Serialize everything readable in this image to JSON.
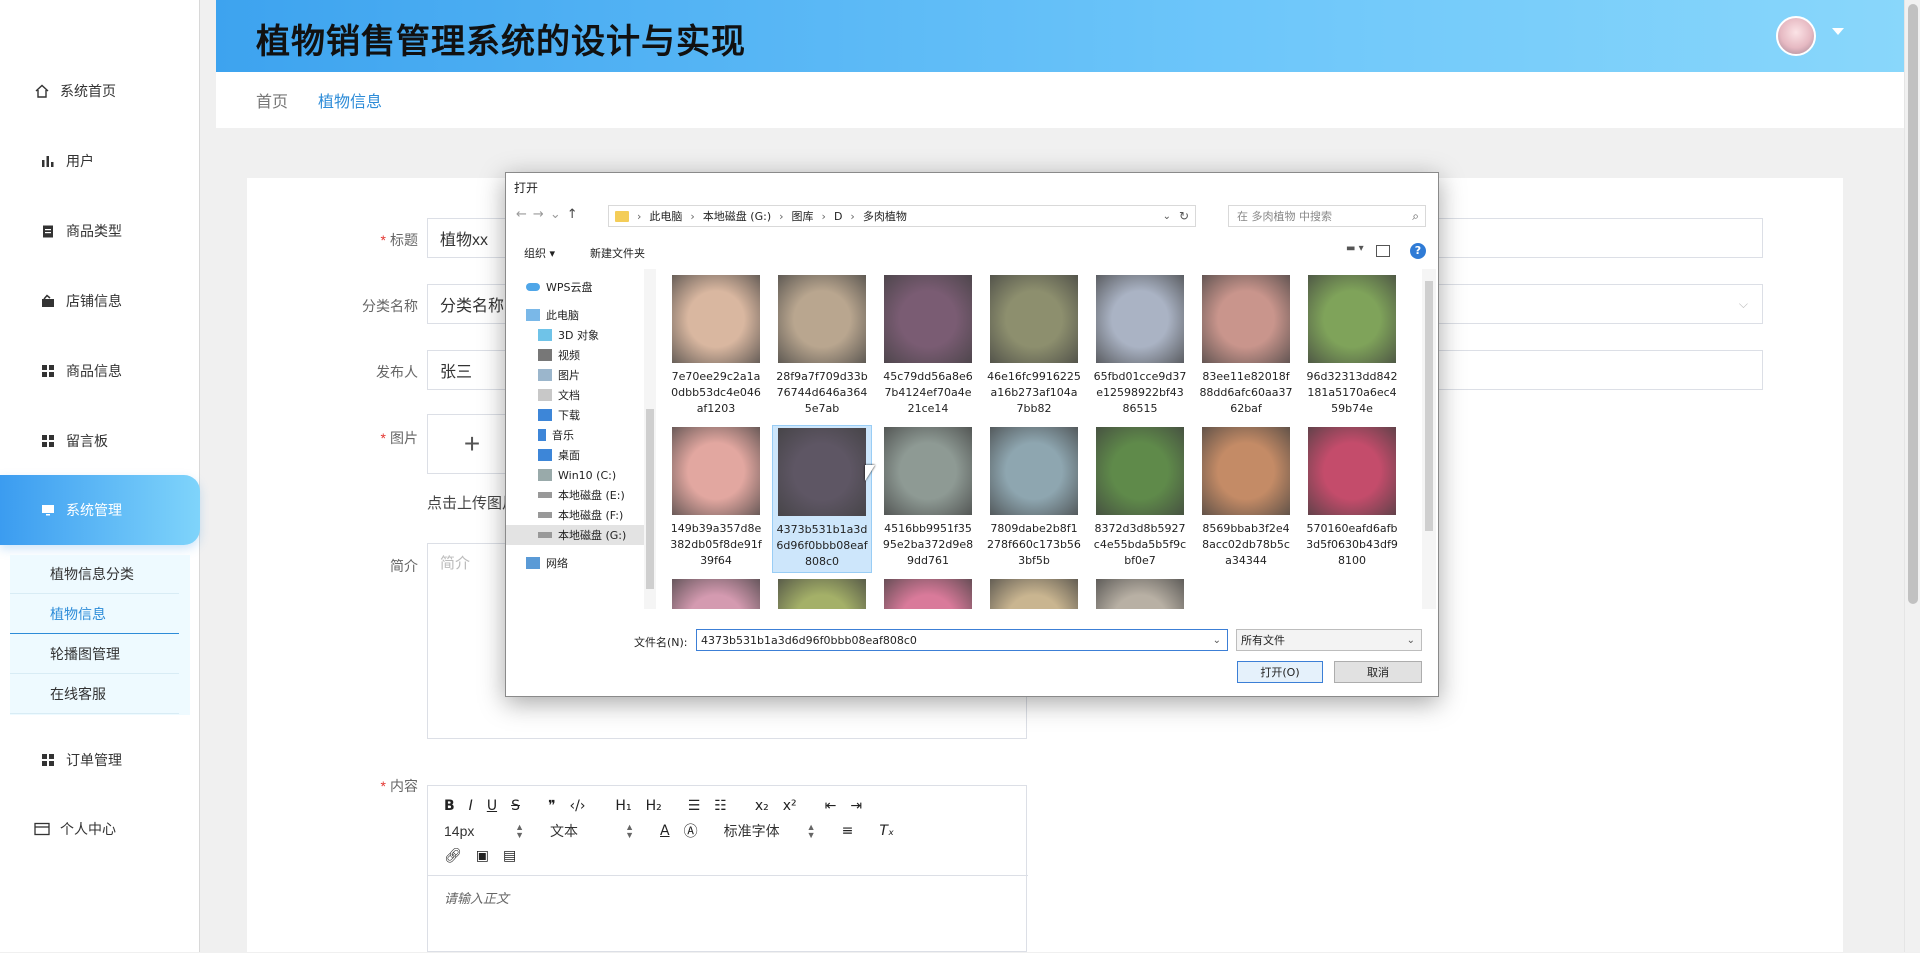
{
  "app": {
    "title": "植物销售管理系统的设计与实现"
  },
  "sidebar": {
    "items": [
      {
        "label": "系统首页",
        "icon": "home-icon"
      },
      {
        "label": "用户",
        "icon": "bar-chart-icon"
      },
      {
        "label": "商品类型",
        "icon": "clipboard-icon"
      },
      {
        "label": "店铺信息",
        "icon": "store-icon"
      },
      {
        "label": "商品信息",
        "icon": "grid-icon"
      },
      {
        "label": "留言板",
        "icon": "grid-icon"
      },
      {
        "label": "系统管理",
        "icon": "monitor-icon"
      },
      {
        "label": "订单管理",
        "icon": "grid-icon"
      },
      {
        "label": "个人中心",
        "icon": "card-icon"
      }
    ],
    "submenu": [
      "植物信息分类",
      "植物信息",
      "轮播图管理",
      "在线客服"
    ]
  },
  "breadcrumb": [
    "首页",
    "植物信息"
  ],
  "form": {
    "title_label": "标题",
    "title_value": "植物xx",
    "category_label": "分类名称",
    "category_value": "分类名称",
    "publisher_label": "发布人",
    "publisher_value": "张三",
    "image_label": "图片",
    "upload_plus": "+",
    "upload_hint": "点击上传图片",
    "intro_label": "简介",
    "intro_placeholder": "简介",
    "content_label": "内容",
    "editor": {
      "font_size": "14px",
      "text_type": "文本",
      "font_family": "标准字体",
      "placeholder": "请输入正文"
    }
  },
  "dialog": {
    "title": "打开",
    "path": [
      "此电脑",
      "本地磁盘 (G:)",
      "图库",
      "D",
      "多肉植物"
    ],
    "search_placeholder": "在 多肉植物 中搜索",
    "organize": "组织",
    "new_folder": "新建文件夹",
    "tree": [
      {
        "label": "WPS云盘",
        "icon": "cloud-icon"
      },
      {
        "label": "此电脑",
        "icon": "computer-icon"
      },
      {
        "label": "3D 对象",
        "icon": "cube-icon"
      },
      {
        "label": "视频",
        "icon": "video-icon"
      },
      {
        "label": "图片",
        "icon": "picture-icon"
      },
      {
        "label": "文档",
        "icon": "document-icon"
      },
      {
        "label": "下载",
        "icon": "download-icon"
      },
      {
        "label": "音乐",
        "icon": "music-icon"
      },
      {
        "label": "桌面",
        "icon": "desktop-icon"
      },
      {
        "label": "Win10 (C:)",
        "icon": "drive-icon"
      },
      {
        "label": "本地磁盘 (E:)",
        "icon": "drive-icon"
      },
      {
        "label": "本地磁盘 (F:)",
        "icon": "drive-icon"
      },
      {
        "label": "本地磁盘 (G:)",
        "icon": "drive-icon"
      },
      {
        "label": "网络",
        "icon": "network-icon"
      }
    ],
    "files": [
      {
        "name": "7e70ee29c2a1a0dbb53dc4e046af1203",
        "color": "#d9b7a0"
      },
      {
        "name": "28f9a7f709d33b76744d646a3645e7ab",
        "color": "#b9a68f"
      },
      {
        "name": "45c79dd56a8e67b4124ef70a4e21ce14",
        "color": "#7a5c73"
      },
      {
        "name": "46e16fc9916225a16b273af104a7bb82",
        "color": "#8d8f6e"
      },
      {
        "name": "65fbd01cce9d37e12598922bf4386515",
        "color": "#aab3c4"
      },
      {
        "name": "83ee11e82018f88dd6afc60aa3762baf",
        "color": "#c9958c"
      },
      {
        "name": "96d32313dd842181a5170a6ec459b74e",
        "color": "#7fa35a"
      },
      {
        "name": "149b39a357d8e382db05f8de91f39f64",
        "color": "#e2a7a0"
      },
      {
        "name": "4373b531b1a3d6d96f0bbb08eaf808c0",
        "color": "#5e5664"
      },
      {
        "name": "4516bb9951f3595e2ba372d9e89dd761",
        "color": "#8e9a94"
      },
      {
        "name": "7809dabe2b8f1278f660c173b563bf5b",
        "color": "#8ea6b0"
      },
      {
        "name": "8372d3d8b5927c4e55bda5b5f9cbf0e7",
        "color": "#5f8a4a"
      },
      {
        "name": "8569bbab3f2e48acc02db78b5ca34344",
        "color": "#c48b66"
      },
      {
        "name": "570160eafd6afb3d5f0630b43df98100",
        "color": "#c44c6b"
      },
      {
        "name": "",
        "color": "#d49ab0"
      },
      {
        "name": "",
        "color": "#a4b068"
      },
      {
        "name": "",
        "color": "#d97a9a"
      },
      {
        "name": "",
        "color": "#c9b590"
      },
      {
        "name": "",
        "color": "#b8b0a4"
      }
    ],
    "filename_label": "文件名(N):",
    "filename_value": "4373b531b1a3d6d96f0bbb08eaf808c0",
    "filetype": "所有文件",
    "open_button": "打开(O)",
    "cancel_button": "取消"
  },
  "colors": {
    "accent": "#2d8cd8",
    "header_start": "#3da3ef",
    "header_end": "#89d7fb",
    "required": "#e3342f"
  }
}
